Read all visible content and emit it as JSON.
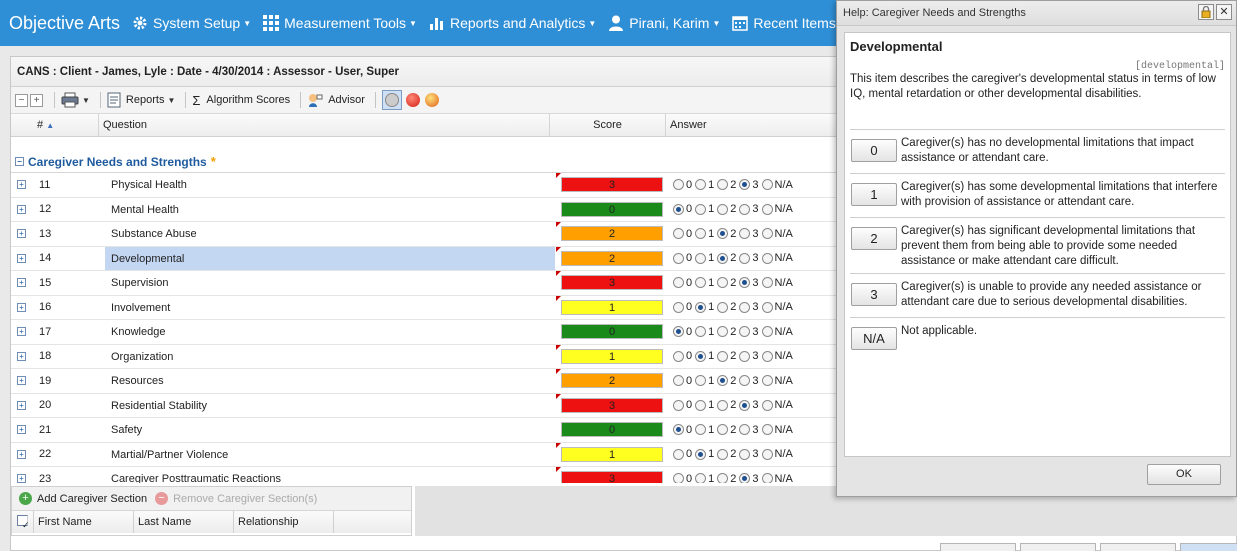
{
  "nav": {
    "brand": "Objective Arts",
    "items": [
      {
        "label": "System Setup",
        "icon": "gear-icon"
      },
      {
        "label": "Measurement Tools",
        "icon": "grid-icon"
      },
      {
        "label": "Reports and Analytics",
        "icon": "bar-chart-icon"
      },
      {
        "label": "Pirani, Karim",
        "icon": "user-icon"
      },
      {
        "label": "Recent Items",
        "icon": "calendar-icon"
      }
    ]
  },
  "header": {
    "title": "CANS : Client - James, Lyle : Date - 4/30/2014 : Assessor - User, Super"
  },
  "toolbar": {
    "reports_label": "Reports",
    "algorithm_label": "Algorithm Scores",
    "advisor_label": "Advisor"
  },
  "columns": {
    "num": "#",
    "question": "Question",
    "score": "Score",
    "answer": "Answer"
  },
  "section": {
    "title": "Caregiver Needs and Strengths",
    "star": "*"
  },
  "answer_options": [
    "0",
    "1",
    "2",
    "3",
    "N/A"
  ],
  "score_colors": {
    "0": "#1a8a1a",
    "1": "#ffff20",
    "2": "#ffa000",
    "3": "#ee1111"
  },
  "rows": [
    {
      "num": "11",
      "question": "Physical Health",
      "score": "3",
      "selected": 3,
      "flag": true
    },
    {
      "num": "12",
      "question": "Mental Health",
      "score": "0",
      "selected": 0,
      "flag": false
    },
    {
      "num": "13",
      "question": "Substance Abuse",
      "score": "2",
      "selected": 2,
      "flag": true
    },
    {
      "num": "14",
      "question": "Developmental",
      "score": "2",
      "selected": 2,
      "flag": true,
      "highlight": true
    },
    {
      "num": "15",
      "question": "Supervision",
      "score": "3",
      "selected": 3,
      "flag": true
    },
    {
      "num": "16",
      "question": "Involvement",
      "score": "1",
      "selected": 1,
      "flag": true
    },
    {
      "num": "17",
      "question": "Knowledge",
      "score": "0",
      "selected": 0,
      "flag": false
    },
    {
      "num": "18",
      "question": "Organization",
      "score": "1",
      "selected": 1,
      "flag": true
    },
    {
      "num": "19",
      "question": "Resources",
      "score": "2",
      "selected": 2,
      "flag": true
    },
    {
      "num": "20",
      "question": "Residential Stability",
      "score": "3",
      "selected": 3,
      "flag": true
    },
    {
      "num": "21",
      "question": "Safety",
      "score": "0",
      "selected": 0,
      "flag": false
    },
    {
      "num": "22",
      "question": "Martial/Partner Violence",
      "score": "1",
      "selected": 1,
      "flag": true
    },
    {
      "num": "23",
      "question": "Caregiver Posttraumatic Reactions",
      "score": "3",
      "selected": 3,
      "flag": true
    }
  ],
  "caregiver": {
    "add_label": "Add Caregiver Section",
    "remove_label": "Remove Caregiver Section(s)",
    "cols": [
      "First Name",
      "Last Name",
      "Relationship"
    ]
  },
  "help": {
    "title": "Help: Caregiver Needs and Strengths",
    "item_title": "Developmental",
    "item_key": "[developmental]",
    "description": "This item describes the caregiver's developmental status in terms of low IQ, mental retardation or other developmental disabilities.",
    "options": [
      {
        "value": "0",
        "text": "Caregiver(s) has no developmental limitations that impact assistance or attendant care."
      },
      {
        "value": "1",
        "text": "Caregiver(s) has some developmental limitations that interfere with provision of assistance or attendant care."
      },
      {
        "value": "2",
        "text": "Caregiver(s) has significant developmental limitations that prevent them from being able to provide some needed assistance or make attendant care difficult."
      },
      {
        "value": "3",
        "text": "Caregiver(s) is unable to provide any needed assistance or attendant care due to serious developmental disabilities."
      },
      {
        "value": "N/A",
        "text": "Not applicable."
      }
    ],
    "ok_label": "OK"
  }
}
